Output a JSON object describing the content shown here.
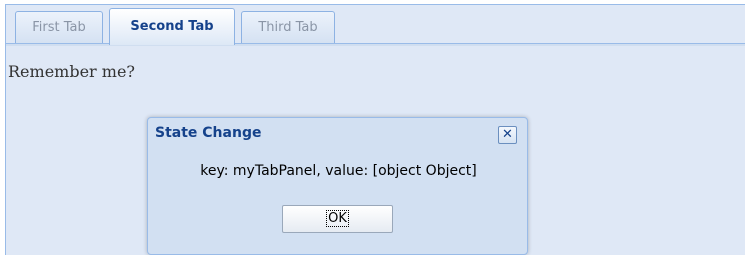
{
  "tabs": [
    {
      "label": "First Tab",
      "active": false
    },
    {
      "label": "Second Tab",
      "active": true
    },
    {
      "label": "Third Tab",
      "active": false
    }
  ],
  "panel": {
    "body_text": "Remember me?"
  },
  "dialog": {
    "title": "State Change",
    "message": "key: myTabPanel, value: [object Object]",
    "ok_label": "OK",
    "close_icon": "close-icon"
  },
  "colors": {
    "panel_background": "#dfe8f6",
    "active_tab_text": "#15428b",
    "inactive_tab_text": "#8a95a6",
    "border": "#99bbe8"
  }
}
